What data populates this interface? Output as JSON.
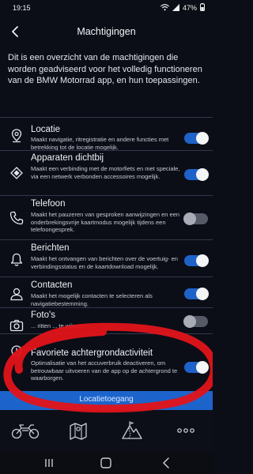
{
  "status": {
    "time": "19:15",
    "battery": "47%"
  },
  "header": {
    "title": "Machtigingen"
  },
  "intro": "Dit is een overzicht van de machtigingen die worden geadviseerd voor het volledig functioneren van de BMW Motorrad app, en hun toepassingen.",
  "permissions": [
    {
      "icon": "location-pin-icon",
      "title": "Locatie",
      "desc": "Maakt navigatie, ritregistratie en andere functies met betrekking tot de locatie mogelijk.",
      "enabled": true
    },
    {
      "icon": "nearby-devices-icon",
      "title": "Apparaten dichtbij",
      "desc": "Maakt een verbinding met de motorfiets en met speciale, via een netwerk verbonden accessoires mogelijk.",
      "enabled": true
    },
    {
      "icon": "phone-icon",
      "title": "Telefoon",
      "desc": "Maakt het pauzeren van gesproken aanwijzingen en een onderbrekingsvrije kaartmodus mogelijk tijdens een telefoongesprek.",
      "enabled": false
    },
    {
      "icon": "bell-icon",
      "title": "Berichten",
      "desc": "Maakt het ontvangen van berichten over de voertuig- en verbindingsstatus en de kaartdownload mogelijk.",
      "enabled": true
    },
    {
      "icon": "contact-icon",
      "title": "Contacten",
      "desc": "Maakt het mogelijk contacten te selecteren als navigatiebestemming.",
      "enabled": true
    },
    {
      "icon": "camera-icon",
      "title": "Foto's",
      "desc": "... ritten ... te wijzen.",
      "enabled": false
    },
    {
      "icon": "background-activity-icon",
      "title": "Favoriete achtergrondactiviteit",
      "desc": "Optimalisatie van het accuverbruik deactiveren, om betrouwbaar uitvoeren van de app op de achtergrond te waarborgen.",
      "enabled": true
    }
  ],
  "bottom_button": "Locatietoegang",
  "nav": [
    {
      "icon": "motorcycle-icon"
    },
    {
      "icon": "map-icon"
    },
    {
      "icon": "mountain-route-icon"
    },
    {
      "icon": "more-dots-icon"
    }
  ],
  "colors": {
    "background": "#0b0e17",
    "accent_blue": "#1f62c8",
    "annotation_red": "#e0141b"
  }
}
